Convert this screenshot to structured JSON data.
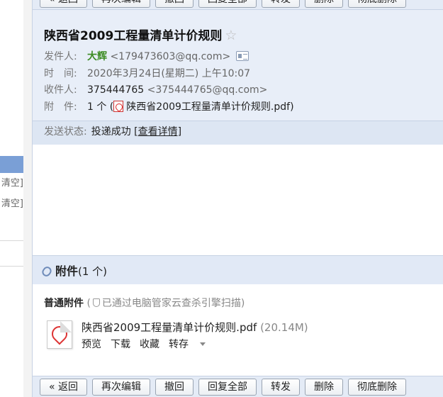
{
  "sidebar": {
    "clear_1": "清空]",
    "clear_2": "清空]"
  },
  "toolbar": {
    "back": "« 返回",
    "edit_again": "再次编辑",
    "recall": "撤回",
    "reply_all": "回复全部",
    "forward": "转发",
    "delete": "删除",
    "delete_forever": "彻底删除"
  },
  "mail": {
    "subject": "陕西省2009工程量清单计价规则",
    "star": "☆",
    "from_label": "发件人:",
    "from_name": "大辉",
    "from_email": "<179473603@qq.com>",
    "time_label": "时　间:",
    "time_value": "2020年3月24日(星期二) 上午10:07",
    "to_label": "收件人:",
    "to_name": "375444765",
    "to_email": "<375444765@qq.com>",
    "att_label": "附　件:",
    "att_count": "1 个 (",
    "att_name": "陕西省2009工程量清单计价规则.pdf",
    "att_close": ")",
    "status_label": "发送状态:",
    "status_value": "投递成功",
    "status_link": "[查看详情]"
  },
  "attachments": {
    "title": "附件",
    "count": "(1 个)",
    "section_label": "普通附件",
    "scan_prefix": "(",
    "scan_text": "已通过电脑管家云查杀引擎扫描)",
    "file_name": "陕西省2009工程量清单计价规则.pdf",
    "file_size": "(20.14M)",
    "actions": {
      "preview": "预览",
      "download": "下载",
      "favorite": "收藏",
      "save_to": "转存"
    }
  }
}
